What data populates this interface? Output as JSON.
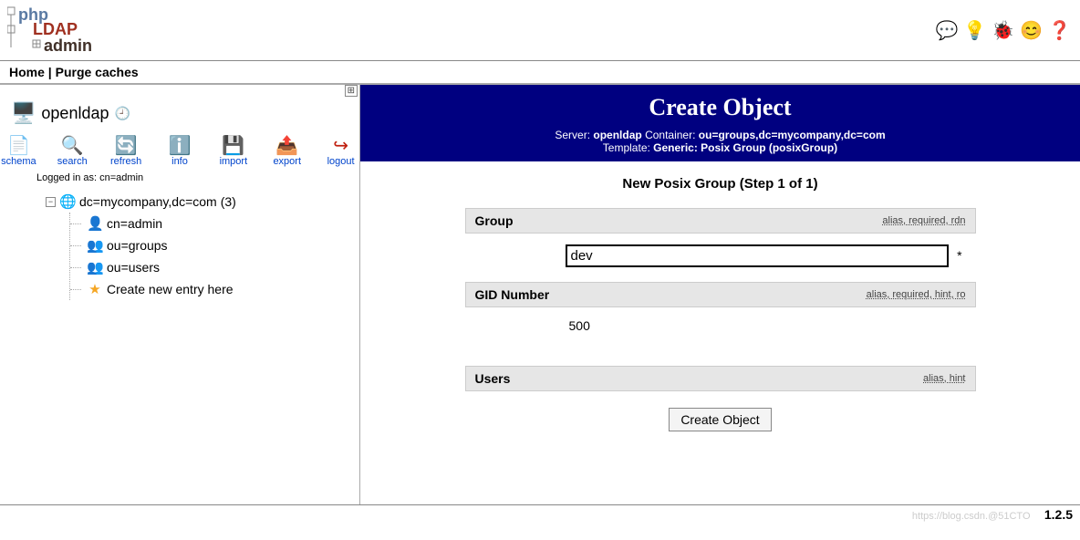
{
  "logo": {
    "alt": "phpLDAPadmin"
  },
  "topnav": {
    "home": "Home",
    "sep": " | ",
    "purge": "Purge caches"
  },
  "sidebar": {
    "server_name": "openldap",
    "toolbar": [
      {
        "key": "schema",
        "label": "schema"
      },
      {
        "key": "search",
        "label": "search"
      },
      {
        "key": "refresh",
        "label": "refresh"
      },
      {
        "key": "info",
        "label": "info"
      },
      {
        "key": "import",
        "label": "import"
      },
      {
        "key": "export",
        "label": "export"
      },
      {
        "key": "logout",
        "label": "logout"
      }
    ],
    "logged_in_prefix": "Logged in as: ",
    "logged_in_user": "cn=admin",
    "root": {
      "label": "dc=mycompany,dc=com",
      "count": "(3)"
    },
    "children": [
      {
        "icon": "person",
        "label": "cn=admin"
      },
      {
        "icon": "group",
        "label": "ou=groups"
      },
      {
        "icon": "group",
        "label": "ou=users"
      },
      {
        "icon": "star",
        "label": "Create new entry here"
      }
    ]
  },
  "content": {
    "title": "Create Object",
    "meta": {
      "server_label": "Server: ",
      "server_value": "openldap",
      "container_label": "   Container: ",
      "container_value": "ou=groups,dc=mycompany,dc=com",
      "template_label": "Template: ",
      "template_value": "Generic: Posix Group (posixGroup)"
    },
    "step_title": "New Posix Group (Step 1 of 1)",
    "fields": [
      {
        "key": "group",
        "label": "Group",
        "hints": "alias, required, rdn",
        "type": "input",
        "value": "dev",
        "required": true
      },
      {
        "key": "gid",
        "label": "GID Number",
        "hints": "alias, required, hint, ro",
        "type": "static",
        "value": "500"
      },
      {
        "key": "users",
        "label": "Users",
        "hints": "alias, hint",
        "type": "empty"
      }
    ],
    "submit_label": "Create Object"
  },
  "footer": {
    "watermark": "https://blog.csdn.@51CTO",
    "version": "1.2.5"
  }
}
